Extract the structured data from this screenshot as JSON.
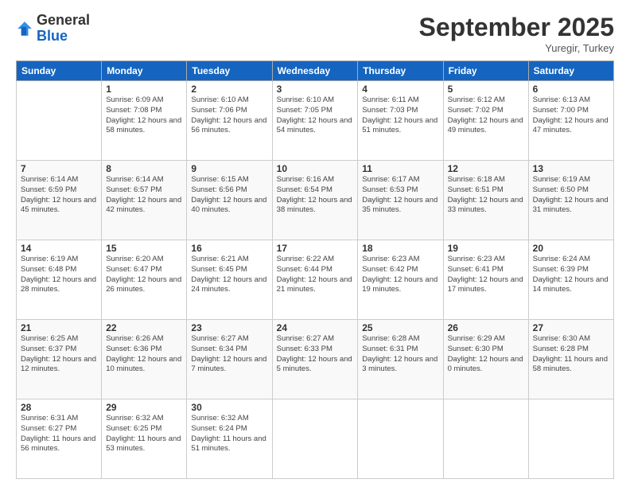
{
  "logo": {
    "general": "General",
    "blue": "Blue"
  },
  "title": "September 2025",
  "location": "Yuregir, Turkey",
  "days_header": [
    "Sunday",
    "Monday",
    "Tuesday",
    "Wednesday",
    "Thursday",
    "Friday",
    "Saturday"
  ],
  "weeks": [
    [
      {
        "day": "",
        "sunrise": "",
        "sunset": "",
        "daylight": ""
      },
      {
        "day": "1",
        "sunrise": "Sunrise: 6:09 AM",
        "sunset": "Sunset: 7:08 PM",
        "daylight": "Daylight: 12 hours and 58 minutes."
      },
      {
        "day": "2",
        "sunrise": "Sunrise: 6:10 AM",
        "sunset": "Sunset: 7:06 PM",
        "daylight": "Daylight: 12 hours and 56 minutes."
      },
      {
        "day": "3",
        "sunrise": "Sunrise: 6:10 AM",
        "sunset": "Sunset: 7:05 PM",
        "daylight": "Daylight: 12 hours and 54 minutes."
      },
      {
        "day": "4",
        "sunrise": "Sunrise: 6:11 AM",
        "sunset": "Sunset: 7:03 PM",
        "daylight": "Daylight: 12 hours and 51 minutes."
      },
      {
        "day": "5",
        "sunrise": "Sunrise: 6:12 AM",
        "sunset": "Sunset: 7:02 PM",
        "daylight": "Daylight: 12 hours and 49 minutes."
      },
      {
        "day": "6",
        "sunrise": "Sunrise: 6:13 AM",
        "sunset": "Sunset: 7:00 PM",
        "daylight": "Daylight: 12 hours and 47 minutes."
      }
    ],
    [
      {
        "day": "7",
        "sunrise": "Sunrise: 6:14 AM",
        "sunset": "Sunset: 6:59 PM",
        "daylight": "Daylight: 12 hours and 45 minutes."
      },
      {
        "day": "8",
        "sunrise": "Sunrise: 6:14 AM",
        "sunset": "Sunset: 6:57 PM",
        "daylight": "Daylight: 12 hours and 42 minutes."
      },
      {
        "day": "9",
        "sunrise": "Sunrise: 6:15 AM",
        "sunset": "Sunset: 6:56 PM",
        "daylight": "Daylight: 12 hours and 40 minutes."
      },
      {
        "day": "10",
        "sunrise": "Sunrise: 6:16 AM",
        "sunset": "Sunset: 6:54 PM",
        "daylight": "Daylight: 12 hours and 38 minutes."
      },
      {
        "day": "11",
        "sunrise": "Sunrise: 6:17 AM",
        "sunset": "Sunset: 6:53 PM",
        "daylight": "Daylight: 12 hours and 35 minutes."
      },
      {
        "day": "12",
        "sunrise": "Sunrise: 6:18 AM",
        "sunset": "Sunset: 6:51 PM",
        "daylight": "Daylight: 12 hours and 33 minutes."
      },
      {
        "day": "13",
        "sunrise": "Sunrise: 6:19 AM",
        "sunset": "Sunset: 6:50 PM",
        "daylight": "Daylight: 12 hours and 31 minutes."
      }
    ],
    [
      {
        "day": "14",
        "sunrise": "Sunrise: 6:19 AM",
        "sunset": "Sunset: 6:48 PM",
        "daylight": "Daylight: 12 hours and 28 minutes."
      },
      {
        "day": "15",
        "sunrise": "Sunrise: 6:20 AM",
        "sunset": "Sunset: 6:47 PM",
        "daylight": "Daylight: 12 hours and 26 minutes."
      },
      {
        "day": "16",
        "sunrise": "Sunrise: 6:21 AM",
        "sunset": "Sunset: 6:45 PM",
        "daylight": "Daylight: 12 hours and 24 minutes."
      },
      {
        "day": "17",
        "sunrise": "Sunrise: 6:22 AM",
        "sunset": "Sunset: 6:44 PM",
        "daylight": "Daylight: 12 hours and 21 minutes."
      },
      {
        "day": "18",
        "sunrise": "Sunrise: 6:23 AM",
        "sunset": "Sunset: 6:42 PM",
        "daylight": "Daylight: 12 hours and 19 minutes."
      },
      {
        "day": "19",
        "sunrise": "Sunrise: 6:23 AM",
        "sunset": "Sunset: 6:41 PM",
        "daylight": "Daylight: 12 hours and 17 minutes."
      },
      {
        "day": "20",
        "sunrise": "Sunrise: 6:24 AM",
        "sunset": "Sunset: 6:39 PM",
        "daylight": "Daylight: 12 hours and 14 minutes."
      }
    ],
    [
      {
        "day": "21",
        "sunrise": "Sunrise: 6:25 AM",
        "sunset": "Sunset: 6:37 PM",
        "daylight": "Daylight: 12 hours and 12 minutes."
      },
      {
        "day": "22",
        "sunrise": "Sunrise: 6:26 AM",
        "sunset": "Sunset: 6:36 PM",
        "daylight": "Daylight: 12 hours and 10 minutes."
      },
      {
        "day": "23",
        "sunrise": "Sunrise: 6:27 AM",
        "sunset": "Sunset: 6:34 PM",
        "daylight": "Daylight: 12 hours and 7 minutes."
      },
      {
        "day": "24",
        "sunrise": "Sunrise: 6:27 AM",
        "sunset": "Sunset: 6:33 PM",
        "daylight": "Daylight: 12 hours and 5 minutes."
      },
      {
        "day": "25",
        "sunrise": "Sunrise: 6:28 AM",
        "sunset": "Sunset: 6:31 PM",
        "daylight": "Daylight: 12 hours and 3 minutes."
      },
      {
        "day": "26",
        "sunrise": "Sunrise: 6:29 AM",
        "sunset": "Sunset: 6:30 PM",
        "daylight": "Daylight: 12 hours and 0 minutes."
      },
      {
        "day": "27",
        "sunrise": "Sunrise: 6:30 AM",
        "sunset": "Sunset: 6:28 PM",
        "daylight": "Daylight: 11 hours and 58 minutes."
      }
    ],
    [
      {
        "day": "28",
        "sunrise": "Sunrise: 6:31 AM",
        "sunset": "Sunset: 6:27 PM",
        "daylight": "Daylight: 11 hours and 56 minutes."
      },
      {
        "day": "29",
        "sunrise": "Sunrise: 6:32 AM",
        "sunset": "Sunset: 6:25 PM",
        "daylight": "Daylight: 11 hours and 53 minutes."
      },
      {
        "day": "30",
        "sunrise": "Sunrise: 6:32 AM",
        "sunset": "Sunset: 6:24 PM",
        "daylight": "Daylight: 11 hours and 51 minutes."
      },
      {
        "day": "",
        "sunrise": "",
        "sunset": "",
        "daylight": ""
      },
      {
        "day": "",
        "sunrise": "",
        "sunset": "",
        "daylight": ""
      },
      {
        "day": "",
        "sunrise": "",
        "sunset": "",
        "daylight": ""
      },
      {
        "day": "",
        "sunrise": "",
        "sunset": "",
        "daylight": ""
      }
    ]
  ]
}
